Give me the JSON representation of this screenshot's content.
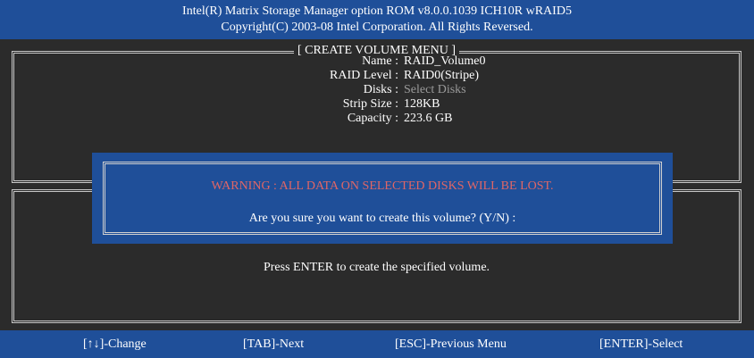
{
  "header": {
    "line1": "Intel(R) Matrix Storage Manager option ROM v8.0.0.1039 ICH10R wRAID5",
    "line2": "Copyright(C) 2003-08 Intel Corporation.  All Rights Reversed."
  },
  "create_menu": {
    "title": "[ CREATE VOLUME MENU ]",
    "fields": [
      {
        "label": "Name :",
        "value": "RAID_Volume0"
      },
      {
        "label": "RAID Level :",
        "value": "RAID0(Stripe)"
      },
      {
        "label": "Disks :",
        "value": "Select Disks"
      },
      {
        "label": "Strip Size :",
        "value": "128KB"
      },
      {
        "label": "Capacity :",
        "value": "223.6 GB"
      }
    ]
  },
  "help": {
    "text": "Press ENTER to create the specified volume."
  },
  "dialog": {
    "warning": "WARNING : ALL DATA ON SELECTED DISKS WILL BE LOST.",
    "question": "Are you sure you want to create this volume? (Y/N) :"
  },
  "footer": {
    "change": "[↑↓]-Change",
    "next": "[TAB]-Next",
    "previous": "[ESC]-Previous Menu",
    "select": "[ENTER]-Select"
  },
  "colors": {
    "header_bg": "#1f4f99",
    "screen_bg": "#2b2b2b",
    "warning": "#e06666",
    "disabled": "#9a9a9a"
  }
}
